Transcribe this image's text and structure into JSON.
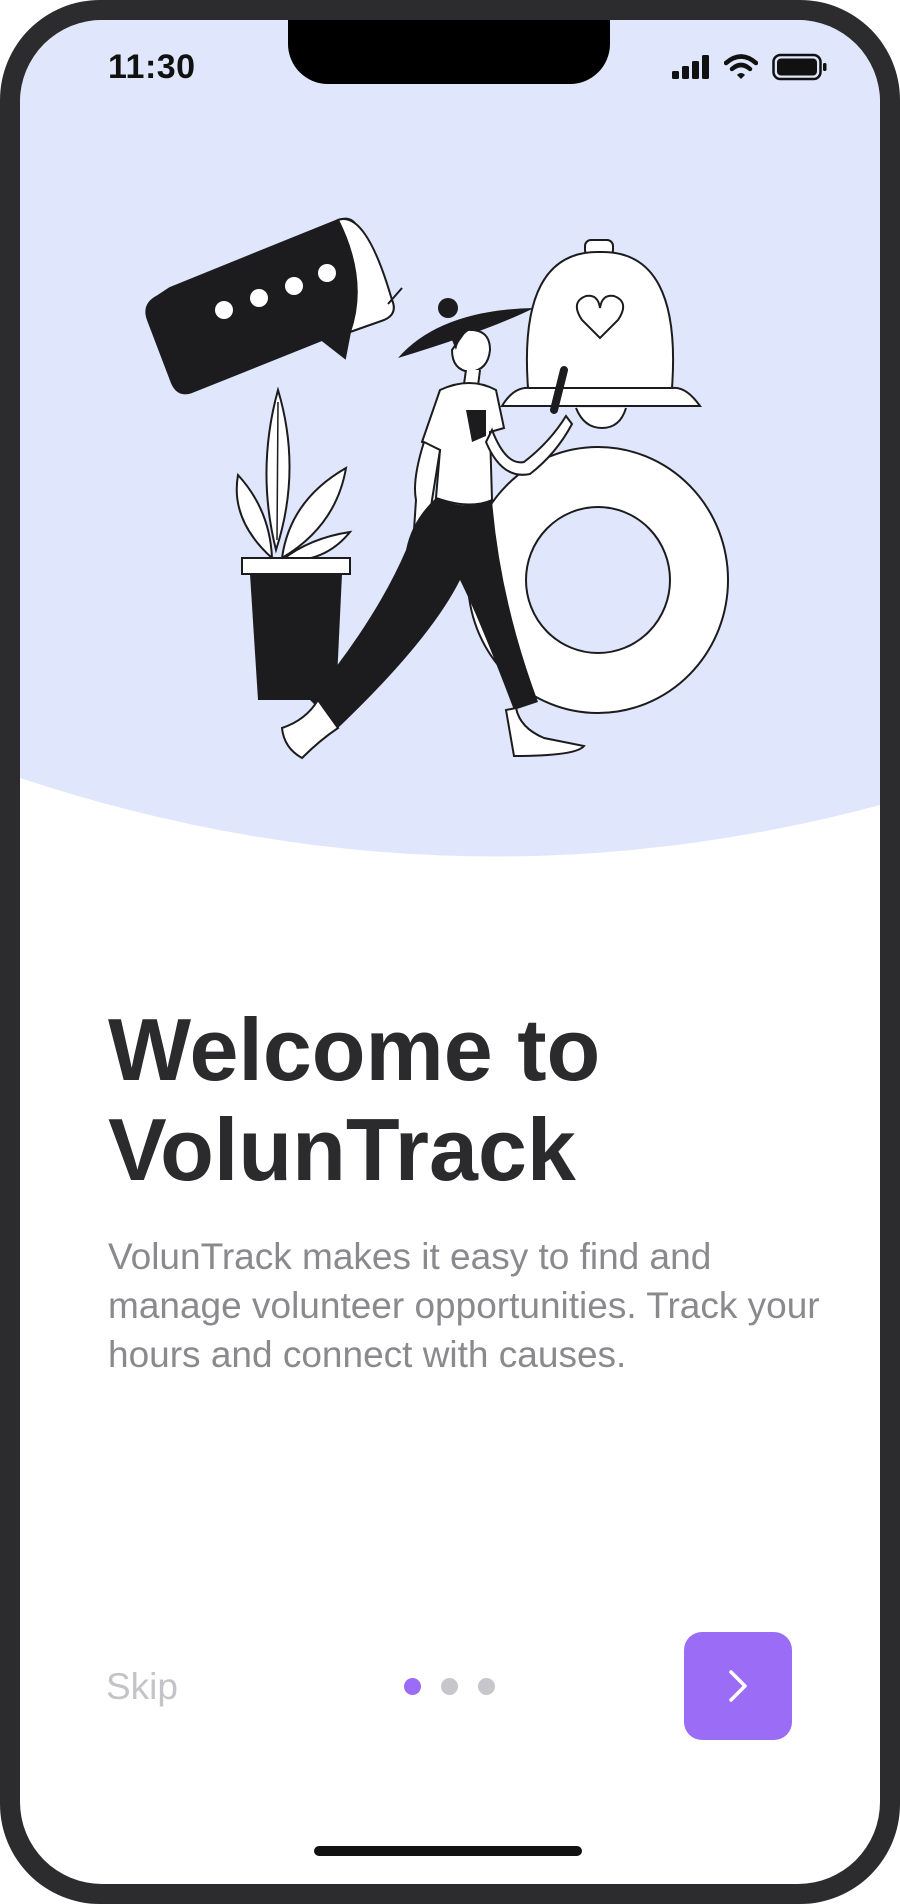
{
  "status_bar": {
    "time": "11:30"
  },
  "onboarding": {
    "title": "Welcome to VolunTrack",
    "description": "VolunTrack makes it easy to find and manage volunteer opportunities. Track your hours and connect with causes.",
    "skip_label": "Skip",
    "page_index": 1,
    "page_count": 3
  },
  "icons": {
    "next": "chevron-right-icon",
    "signal": "cellular-signal-icon",
    "wifi": "wifi-icon",
    "battery": "battery-icon"
  },
  "colors": {
    "hero_background": "#e0e6fb",
    "accent": "#9b6cf6",
    "title": "#2b2b2d",
    "body_text": "#8a8a8e",
    "skip_text": "#c4c4c8",
    "inactive_dot": "#c7c7cb"
  }
}
